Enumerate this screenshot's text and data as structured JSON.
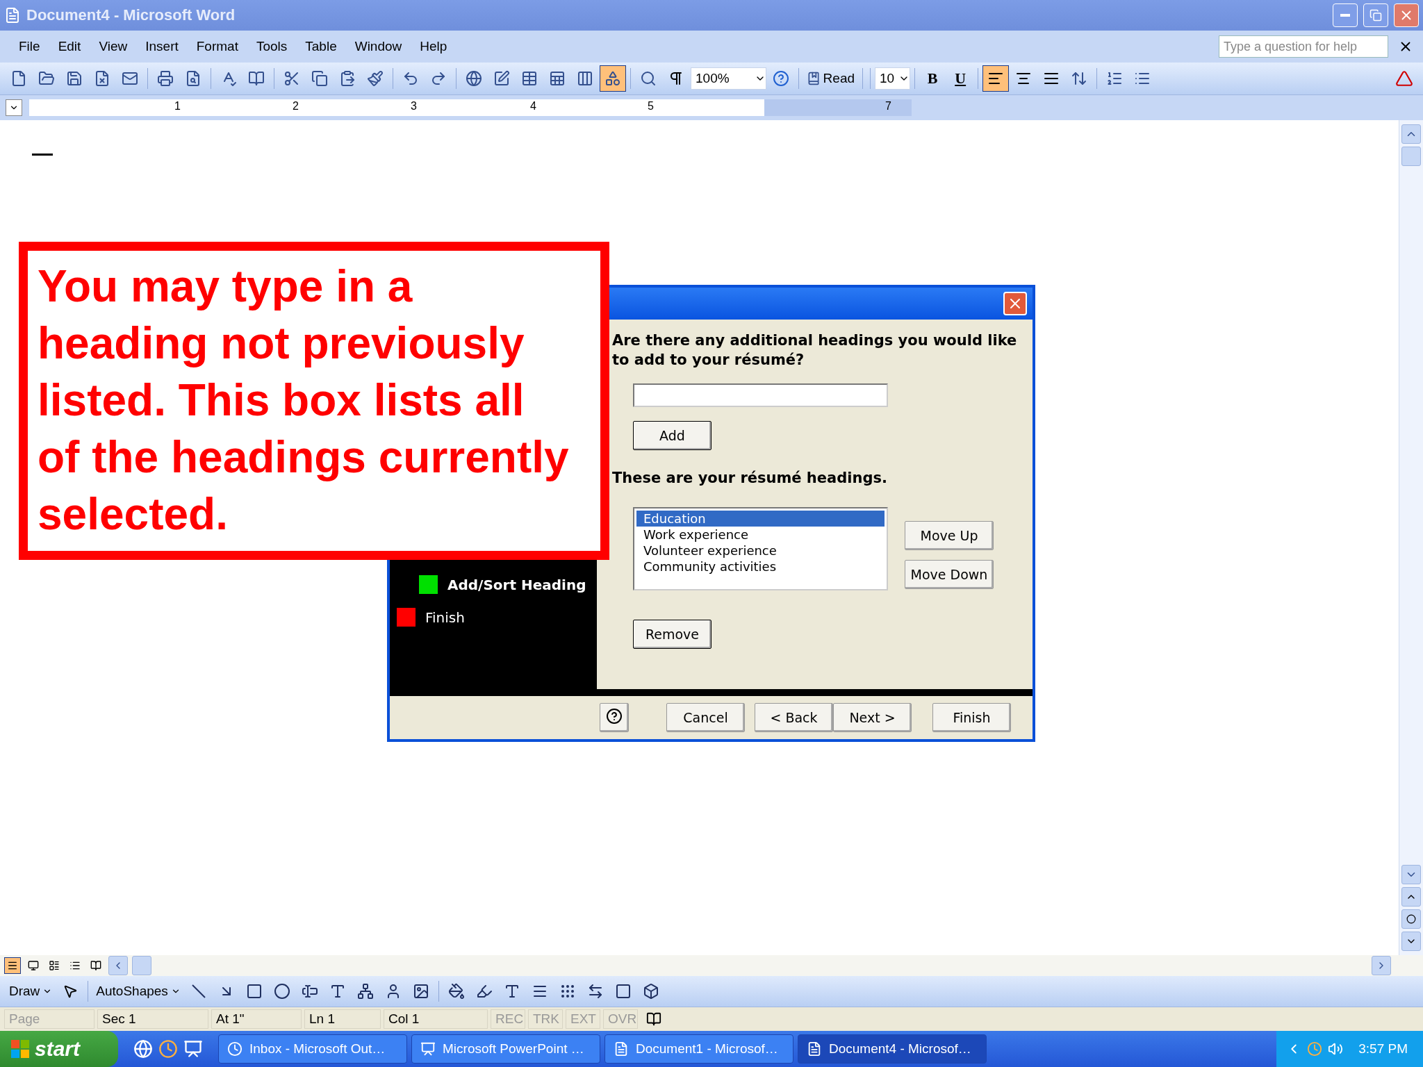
{
  "window": {
    "title": "Document4 - Microsoft Word"
  },
  "menu": [
    "File",
    "Edit",
    "View",
    "Insert",
    "Format",
    "Tools",
    "Table",
    "Window",
    "Help"
  ],
  "help_box": {
    "placeholder": "Type a question for help"
  },
  "standard_toolbar": {
    "drawing_selected": true,
    "zoom": "100%",
    "read": "Read"
  },
  "formatting_toolbar": {
    "font_size": "10",
    "bold": "B",
    "underline": "U",
    "alignment": [
      {
        "selected": true
      },
      {
        "selected": false
      },
      {
        "selected": false
      }
    ]
  },
  "ruler": {
    "labels": [
      "1",
      "2",
      "3",
      "4",
      "5",
      "7"
    ]
  },
  "callout": {
    "text": "You may type in a heading not previously listed. This box lists all of the headings currently selected."
  },
  "dialog": {
    "question": "Are there any additional headings you would like to add to your résumé?",
    "add_button": "Add",
    "headings_label": "These are your résumé headings.",
    "headings": [
      {
        "label": "Education",
        "selected": true
      },
      {
        "label": "Work experience",
        "selected": false
      },
      {
        "label": "Volunteer experience",
        "selected": false
      },
      {
        "label": "Community activities",
        "selected": false
      }
    ],
    "side_buttons": [
      "Move Up",
      "Move Down"
    ],
    "remove_button": "Remove",
    "steps": [
      {
        "label": "Add/Sort Heading",
        "color": "#00e000",
        "current": true
      },
      {
        "label": "Finish",
        "color": "#ff0000",
        "current": false
      }
    ],
    "footer_buttons": [
      "Cancel",
      "< Back",
      "Next >",
      "Finish"
    ]
  },
  "view_buttons": [
    {
      "selected": true
    },
    {
      "selected": false
    },
    {
      "selected": false
    },
    {
      "selected": false
    },
    {
      "selected": false
    }
  ],
  "drawing_toolbar": {
    "draw": "Draw",
    "autoshapes": "AutoShapes"
  },
  "status_bar": [
    {
      "text": "Page"
    },
    {
      "text": "Sec 1"
    },
    {
      "text": "At 1\""
    },
    {
      "text": "Ln 1"
    },
    {
      "text": "Col 1"
    },
    {
      "text": "REC"
    },
    {
      "text": "TRK"
    },
    {
      "text": "EXT"
    },
    {
      "text": "OVR"
    }
  ],
  "taskbar": {
    "start": "start",
    "tasks": [
      {
        "label": "Inbox - Microsoft Out…",
        "selected": false
      },
      {
        "label": "Microsoft PowerPoint …",
        "selected": false
      },
      {
        "label": "Document1 - Microsof…",
        "selected": false
      },
      {
        "label": "Document4 - Microsof…",
        "selected": true
      }
    ],
    "clock": "3:57 PM"
  }
}
